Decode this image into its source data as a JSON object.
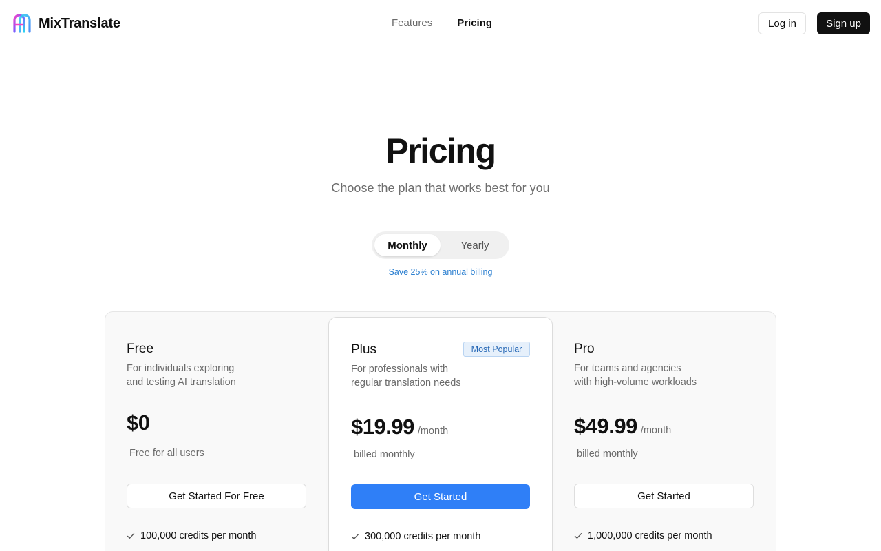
{
  "header": {
    "brand": "MixTranslate",
    "logo_icon": "mixtranslate-logo-icon",
    "nav": [
      {
        "label": "Features",
        "active": false
      },
      {
        "label": "Pricing",
        "active": true
      }
    ],
    "login_label": "Log in",
    "signup_label": "Sign up"
  },
  "hero": {
    "title": "Pricing",
    "subtitle": "Choose the plan that works best for you"
  },
  "billing_toggle": {
    "options": [
      "Monthly",
      "Yearly"
    ],
    "selected": "Monthly",
    "note": "Save 25% on annual billing"
  },
  "plans": [
    {
      "name": "Free",
      "description_line1": "For individuals exploring",
      "description_line2": "and testing AI translation",
      "price": "$0",
      "period": "",
      "price_note": "Free for all users",
      "cta": "Get Started For Free",
      "features": [
        "100,000 credits per month"
      ]
    },
    {
      "name": "Plus",
      "badge": "Most Popular",
      "description_line1": "For professionals with",
      "description_line2": "regular translation needs",
      "price": "$19.99",
      "period": "/month",
      "price_note": "billed monthly",
      "cta": "Get Started",
      "features": [
        "300,000 credits per month"
      ]
    },
    {
      "name": "Pro",
      "description_line1": "For teams and agencies",
      "description_line2": "with high-volume workloads",
      "price": "$49.99",
      "period": "/month",
      "price_note": "billed monthly",
      "cta": "Get Started",
      "features": [
        "1,000,000 credits per month"
      ]
    }
  ],
  "colors": {
    "accent": "#2f7ff7",
    "save_note": "#2b7fd0",
    "badge_bg": "#e6f0fb",
    "signup_bg": "#111111"
  }
}
